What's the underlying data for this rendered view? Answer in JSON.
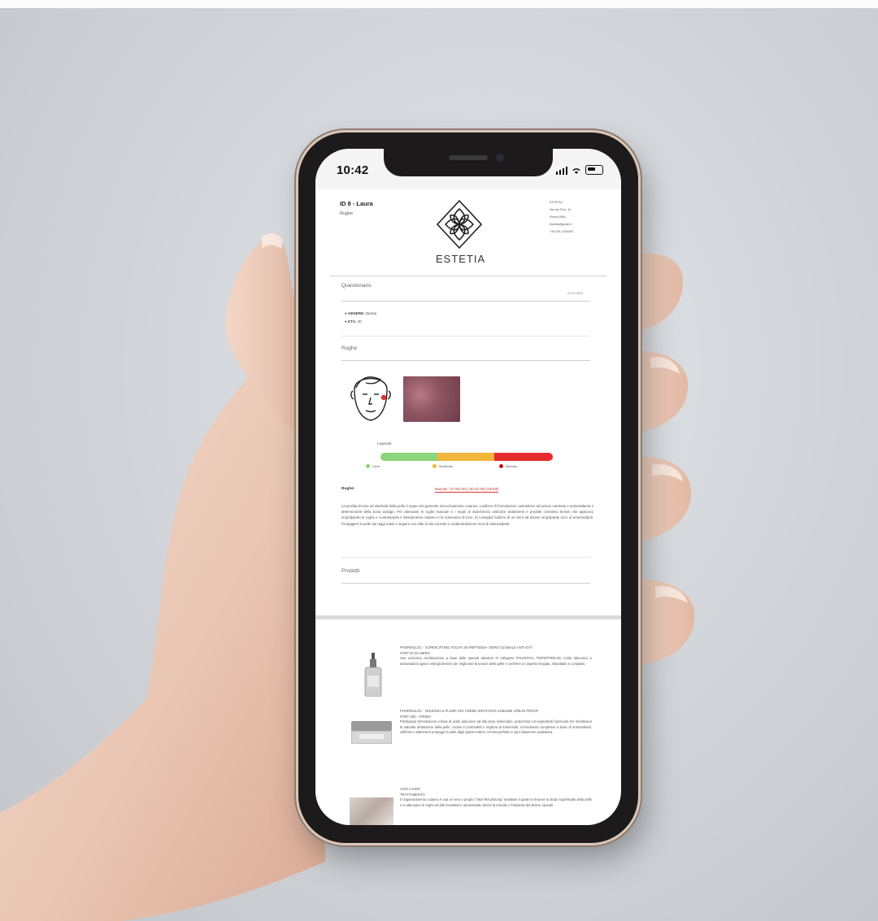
{
  "status_bar": {
    "time": "10:42"
  },
  "header": {
    "id": "ID 8 - Laura",
    "subtitle": "Rughe",
    "brand": "ESTETIA",
    "contact": [
      "ESTETIA",
      "Via dei Fiori, 10",
      "Roma (RM)",
      "estetia@gmail.it",
      "+39 051 1234567"
    ]
  },
  "questionario": {
    "title": "Questionario",
    "date": "01.01.2024",
    "items": [
      {
        "label": "GENERE:",
        "value": "Donna"
      },
      {
        "label": "ETÀ:",
        "value": "40"
      }
    ]
  },
  "rughe": {
    "title": "Rughe",
    "legend_title": "Legenda",
    "legend": [
      {
        "label": "Lieve",
        "color": "#8dd47a"
      },
      {
        "label": "Moderato",
        "color": "#f2b63a"
      },
      {
        "label": "Marcato",
        "color": "#e52b2b"
      }
    ],
    "result_label": "Rughe:",
    "result_value": "Marcate - (0.75/1.00), (40.0/1.00) (18/100)",
    "paragraph": "La perdita di tono ed elasticità della pelle è segno del generale invecchiamento cutaneo. L'utilizzo di formulazioni cosmetiche ad azione nutriente e antiossidante è determinante della bona actiage. Per attenuare le rughe marcate e i segni di stanchezza utilizzare trattamenti e prodotti cosmetici tensivi che agiscono rimpolpando le rughe e contrastando il rilassamento cutaneo e la mancanza di tono. Si consiglia l'utilizzo di un siero ad azione rimpolpante ricco di antiossidanti. Proteggere la pelle dai raggi solari e seguire uno stile di vita corretto e un'alimentazione ricca di antiossidanti."
  },
  "prodotti": {
    "title": "Prodotti",
    "items": [
      {
        "title": "PHORMULOC - SUPERLIFTING YOUTH 3H PEPTIDES+ SIERO GLOBALE ANTI-ETÀ",
        "step": "STEP 01-04 SIERO",
        "text": "Una esclusiva combinazione a base delle speciali attivatori di collagene PALMITOYL TRIPEPTIDE-38, Acido Ialuronico e antiossidanti agisce sinergicamente per migliorare la texture della pelle e conferire un aspetto levigato, rimpolpato e compatto."
      },
      {
        "title": "PHORMULOC - NOURISH & PLUMP 24H CREMA IDRATANTE SUBLIME URBAN PROOF",
        "step": "STEP 1B0 - CREMA",
        "text": "Prestigiosa formulazione a base di acido ialuronico ad alto peso molecolare, potenziata con ingredienti funzionali che ripristinano la naturale idratazione della pelle, risolve in profondità e migliora la luminosità. Un'esclusiva complesso a base di antiossidanti, caffeina e vitamina E protegge la pelle dagli agenti esterni. Crema perfetta in ogni situazione quotidiana."
      },
      {
        "title": "VISO LASER",
        "step": "TRATTAMENTO",
        "text": "Il ringiovanimento cutaneo è una un vero e proprio \"Skin Resurfacing\" mediante il quale si rimuove lo strato superficiale della pelle e si attenuano le rughe ed altri inestetismi, aumentando anche la tonicità e l'elasticità del derma. Questo"
      }
    ]
  },
  "colors": {
    "accent_red": "#d33333",
    "legend_green": "#8dd47a",
    "legend_orange": "#f2b63a",
    "legend_red": "#e52b2b"
  }
}
